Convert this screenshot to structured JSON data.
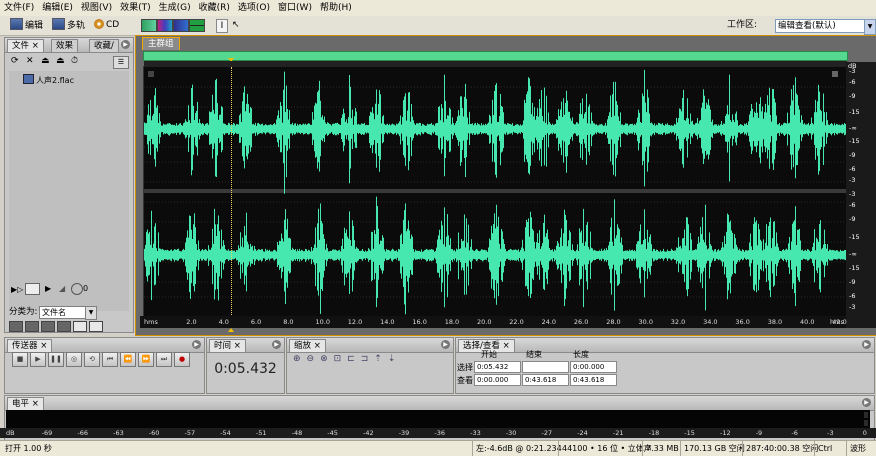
{
  "menu": [
    "文件(F)",
    "编辑(E)",
    "视图(V)",
    "效果(T)",
    "生成(G)",
    "收藏(R)",
    "选项(O)",
    "窗口(W)",
    "帮助(H)"
  ],
  "toolbar": {
    "edit_label": "编辑",
    "multitrack_label": "多轨",
    "cd_label": "CD",
    "workspace_label": "工作区:",
    "workspace_value": "编辑查看(默认)"
  },
  "files_panel": {
    "tabs": [
      "文件",
      "效果",
      "收藏/"
    ],
    "items": [
      {
        "name": "人声2.flac"
      }
    ],
    "sort_label": "分类为:",
    "sort_value": "文件名"
  },
  "editor": {
    "tab": "主群组",
    "db_unit": "dB",
    "db_labels_ch1": [
      "-3",
      "-6",
      "-9",
      "-15",
      "-∞",
      "-15",
      "-9",
      "-6",
      "-3"
    ],
    "db_labels_ch2": [
      "-3",
      "-6",
      "-9",
      "-15",
      "-∞",
      "-15",
      "-9",
      "-6",
      "-3"
    ],
    "time_labels": [
      "hms",
      "2.0",
      "4.0",
      "6.0",
      "8.0",
      "10.0",
      "12.0",
      "14.0",
      "16.0",
      "18.0",
      "20.0",
      "22.0",
      "24.0",
      "26.0",
      "28.0",
      "30.0",
      "32.0",
      "34.0",
      "36.0",
      "38.0",
      "40.0",
      "42.0",
      "hms"
    ],
    "waveform_color": "#47e8b0"
  },
  "transport": {
    "tab": "传送器"
  },
  "time_panel": {
    "tab": "时间",
    "value": "0:05.432"
  },
  "zoom_panel": {
    "tab": "缩放"
  },
  "selection_panel": {
    "tab": "选择/查看",
    "col_start": "开始",
    "col_end": "结束",
    "col_length": "长度",
    "row_selection": "选择",
    "row_view": "查看",
    "sel_start": "0:05.432",
    "sel_end": "",
    "sel_length": "0:00.000",
    "view_start": "0:00.000",
    "view_end": "0:43.618",
    "view_length": "0:43.618"
  },
  "level_panel": {
    "tab": "电平",
    "scale": [
      "dB",
      "-69",
      "-66",
      "-63",
      "-60",
      "-57",
      "-54",
      "-51",
      "-48",
      "-45",
      "-42",
      "-39",
      "-36",
      "-33",
      "-30",
      "-27",
      "-24",
      "-21",
      "-18",
      "-15",
      "-12",
      "-9",
      "-6",
      "-3",
      "0"
    ]
  },
  "status": {
    "left": "打开 1.00 秒",
    "level": "左:-4.6dB @  0:21.234",
    "format": "44100 • 16 位 • 立体声",
    "size": "7.33 MB",
    "free_space": "170.13 GB 空闲",
    "free_time": "287:40:00.38 空闲",
    "ctrl": "Ctrl",
    "mode": "波形"
  },
  "colors": {
    "accent": "#f0a800",
    "waveform": "#47e8b0",
    "background": "#d4d0c8"
  }
}
